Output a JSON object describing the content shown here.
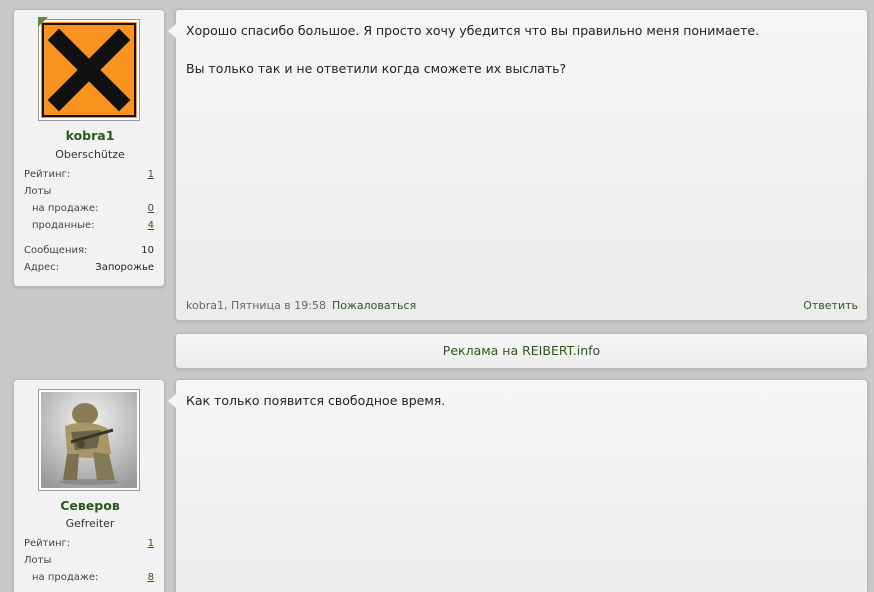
{
  "posts": [
    {
      "user": {
        "name": "kobra1",
        "title": "Oberschütze",
        "avatar_icon": "hazard-x-icon",
        "stats": {
          "rating_label": "Рейтинг:",
          "rating_value": "1",
          "lots_label": "Лоты",
          "on_sale_label": "на продаже:",
          "on_sale_value": "0",
          "sold_label": "проданные:",
          "sold_value": "4",
          "messages_label": "Сообщения:",
          "messages_value": "10",
          "address_label": "Адрес:",
          "address_value": "Запорожье"
        }
      },
      "message": {
        "line1": "Хорошо спасибо большое. Я просто хочу убедится что вы правильно меня понимаете.",
        "line2": "Вы только так и не ответили когда сможете их выслать?"
      },
      "meta": {
        "author_time": "kobra1, Пятница в 19:58",
        "report_label": "Пожаловаться",
        "reply_label": "Ответить"
      }
    },
    {
      "user": {
        "name": "Северов",
        "title": "Gefreiter",
        "avatar_icon": "soldier-photo-icon",
        "stats": {
          "rating_label": "Рейтинг:",
          "rating_value": "1",
          "lots_label": "Лоты",
          "on_sale_label": "на продаже:",
          "on_sale_value": "8"
        }
      },
      "message": {
        "line1": "Как только появится свободное время."
      }
    }
  ],
  "ad": {
    "label": "Реклама на REIBERT.info"
  },
  "colors": {
    "accent_green": "#2a5a1a",
    "hazard_orange": "#f7931e"
  }
}
